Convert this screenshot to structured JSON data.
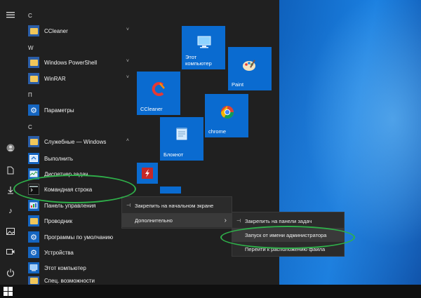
{
  "menu": {
    "headers": [
      "C",
      "W",
      "П",
      "С"
    ],
    "items": [
      {
        "label": "CCleaner",
        "icon": "folder-icon",
        "chevron": "˅"
      },
      {
        "label": "Windows PowerShell",
        "icon": "folder-icon",
        "chevron": "˅"
      },
      {
        "label": "WinRAR",
        "icon": "folder-icon",
        "chevron": "˅"
      },
      {
        "label": "Параметры",
        "icon": "gear-icon"
      },
      {
        "label": "Служебные — Windows",
        "icon": "folder-icon",
        "chevron": "˄"
      },
      {
        "label": "Выполнить",
        "icon": "run-icon"
      },
      {
        "label": "Диспетчер задач",
        "icon": "task-manager-icon"
      },
      {
        "label": "Командная строка",
        "icon": "cmd-icon"
      },
      {
        "label": "Панель управления",
        "icon": "control-panel-icon"
      },
      {
        "label": "Проводник",
        "icon": "explorer-icon"
      },
      {
        "label": "Программы по умолчанию",
        "icon": "gear-icon"
      },
      {
        "label": "Устройства",
        "icon": "gear-icon"
      },
      {
        "label": "Этот компьютер",
        "icon": "computer-icon"
      },
      {
        "label": "Спец. возможности",
        "icon": "folder-icon"
      }
    ]
  },
  "tiles": [
    {
      "label": "Этот компьютер",
      "icon": "computer-icon"
    },
    {
      "label": "Paint",
      "icon": "paint-icon"
    },
    {
      "label": "CCleaner",
      "icon": "ccleaner-icon"
    },
    {
      "label": "chrome",
      "icon": "chrome-icon"
    },
    {
      "label": "Блокнот",
      "icon": "notepad-icon"
    },
    {
      "label": "",
      "icon": "flash-icon"
    }
  ],
  "context_menu_1": [
    {
      "label": "Закрепить на начальном экране",
      "icon": "pin-icon"
    },
    {
      "label": "Дополнительно",
      "icon": "",
      "arrow": "›"
    }
  ],
  "context_menu_2": [
    {
      "label": "Закрепить на панели задач",
      "icon": "pin-icon"
    },
    {
      "label": "Запуск от имени администратора",
      "icon": ""
    },
    {
      "label": "Перейти к расположению файла",
      "icon": ""
    }
  ],
  "colors": {
    "menu_bg": "#202020",
    "tile_blue": "#0a6bd0",
    "highlight": "#2fb04a"
  }
}
